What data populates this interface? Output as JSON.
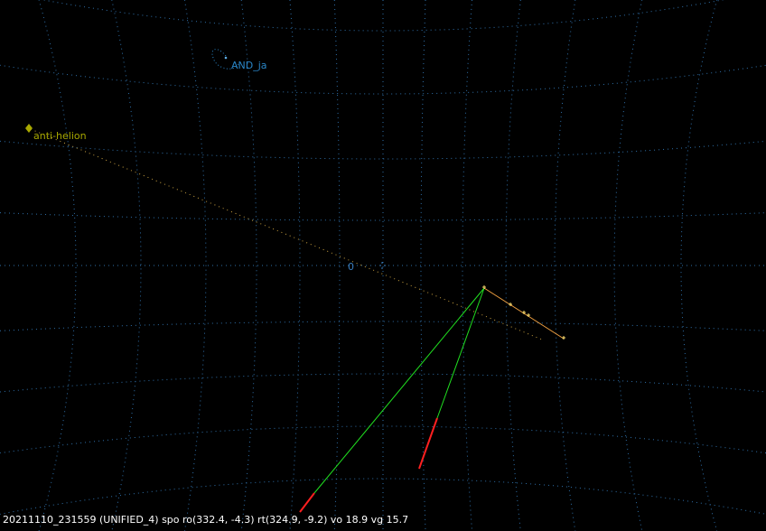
{
  "labels": {
    "radiant": "AND_ja",
    "anti_helion": "anti-helion",
    "origin": "0"
  },
  "status": {
    "text": "20211110_231559 (UNIFIED_4) spo ro(332.4, -4.3) rt(324.9, -9.2) vo 18.9 vg 15.7"
  },
  "colors": {
    "background": "#000000",
    "grid": "#2f6fa8",
    "radiant": "#2a86c8",
    "anti_helion": "#a8a800",
    "origin_label": "#3a7fc0",
    "meteor_track": "#f0a040",
    "meteor_points": "#ffe070",
    "projection_line": "#20e020",
    "projection_tail": "#ff2020",
    "status_text": "#ffffff"
  }
}
